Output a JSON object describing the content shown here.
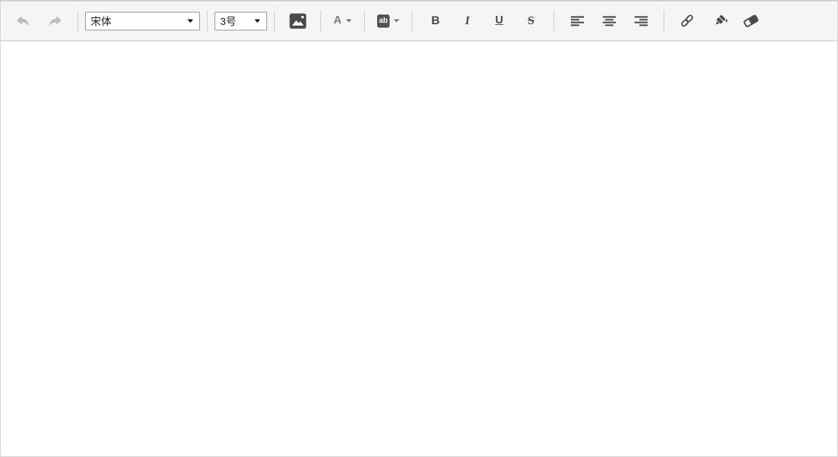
{
  "toolbar": {
    "undo": {
      "icon": "undo-arrow",
      "enabled": false
    },
    "redo": {
      "icon": "redo-arrow",
      "enabled": false
    },
    "font_family": {
      "value": "宋体"
    },
    "font_size": {
      "value": "3号"
    },
    "insert_image": {
      "icon": "image"
    },
    "font_color": {
      "label": "A"
    },
    "highlight_color": {
      "label": "ab"
    },
    "bold": {
      "label": "B"
    },
    "italic": {
      "label": "I"
    },
    "underline": {
      "label": "U"
    },
    "strikethrough": {
      "label": "S"
    },
    "align_left": {
      "icon": "align-left"
    },
    "align_center": {
      "icon": "align-center"
    },
    "align_right": {
      "icon": "align-right"
    },
    "link": {
      "icon": "link"
    },
    "format_brush": {
      "icon": "format-brush"
    },
    "eraser": {
      "icon": "eraser"
    }
  },
  "content": {
    "text": ""
  },
  "colors": {
    "toolbar_background": "#f5f5f5",
    "toolbar_divider": "#d8dee6",
    "frame_border": "#d2d2d2",
    "icon": "#4a4a4a",
    "icon_disabled": "#bcbcbc",
    "separator": "#cbcbcb",
    "highlight_chip_background": "#535353"
  }
}
